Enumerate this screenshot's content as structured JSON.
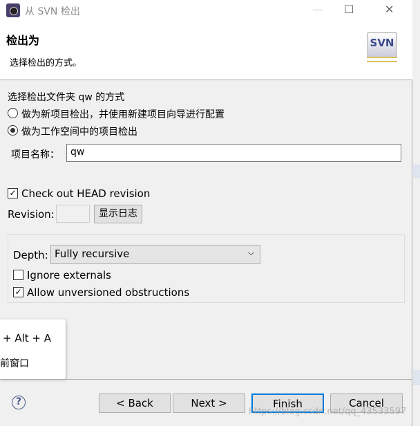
{
  "window": {
    "title": "从 SVN 检出",
    "minimize": "—",
    "maximize": "☐",
    "close": "✕"
  },
  "header": {
    "title": "检出为",
    "description": "选择检出的方式。",
    "logo": "SVN"
  },
  "form": {
    "method_label": "选择检出文件夹 qw 的方式",
    "option_new_project": "做为新项目检出，并使用新建项目向导进行配置",
    "option_workspace_project": "做为工作空间中的项目检出",
    "selected_option": "option_workspace_project",
    "project_name_label": "项目名称：",
    "project_name_value": "qw",
    "head_revision_label": "Check out HEAD revision",
    "head_revision_checked": true,
    "revision_label": "Revision:",
    "revision_value": "",
    "show_log_label": "显示日志",
    "depth_label": "Depth:",
    "depth_value": "Fully recursive",
    "ignore_externals_label": "Ignore externals",
    "ignore_externals_checked": false,
    "allow_unversioned_label": "Allow unversioned obstructions",
    "allow_unversioned_checked": true
  },
  "tooltip": {
    "line1": "+ Alt + A",
    "line2": "前窗口"
  },
  "footer": {
    "help": "?",
    "back": "< Back",
    "next": "Next >",
    "finish": "Finish",
    "cancel": "Cancel"
  },
  "watermark": "https://blog.csdn.net/qq_43533597"
}
